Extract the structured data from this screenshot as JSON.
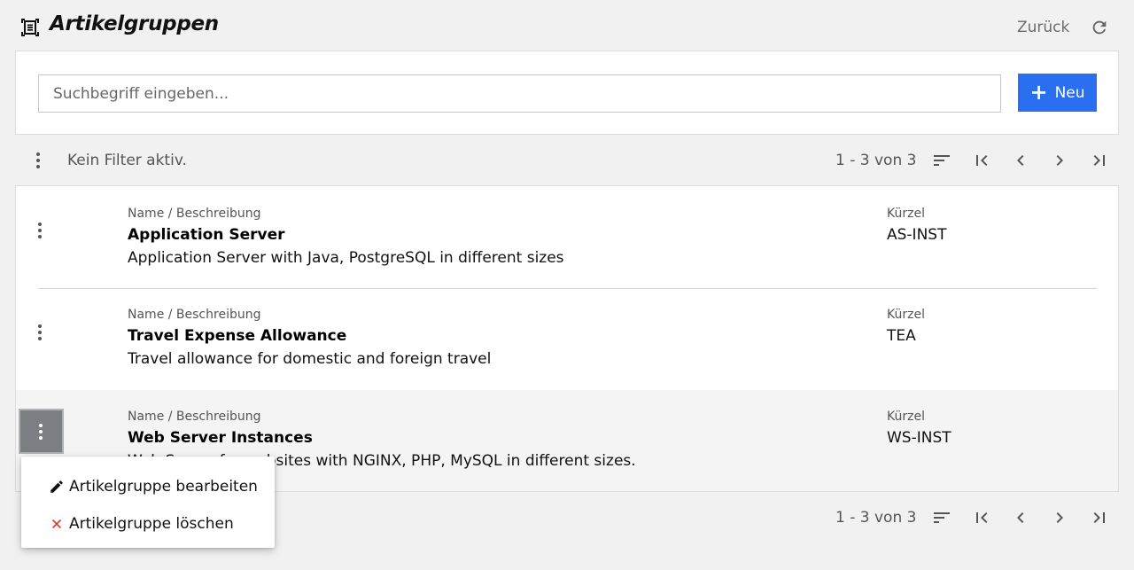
{
  "header": {
    "title": "Artikelgruppen",
    "back_label": "Zurück"
  },
  "search": {
    "placeholder": "Suchbegriff eingeben...",
    "value": "",
    "new_label": "Neu"
  },
  "toolbar": {
    "filter_text": "Kein Filter aktiv.",
    "pager_count": "1 - 3 von 3"
  },
  "list": {
    "name_header": "Name / Beschreibung",
    "code_header": "Kürzel",
    "items": [
      {
        "name": "Application Server",
        "description": "Application Server with Java, PostgreSQL in different sizes",
        "code": "AS-INST"
      },
      {
        "name": "Travel Expense Allowance",
        "description": "Travel allowance for domestic and foreign travel",
        "code": "TEA"
      },
      {
        "name": "Web Server Instances",
        "description": "Web Server for websites with NGINX, PHP, MySQL in different sizes.",
        "code": "WS-INST"
      }
    ]
  },
  "context_menu": {
    "edit_label": "Artikelgruppe bearbeiten",
    "delete_label": "Artikelgruppe löschen"
  },
  "colors": {
    "accent": "#2a6ff0",
    "delete": "#e53935",
    "selected_menu_button": "#7b7e82"
  },
  "icons": {
    "logo": "list-frame-icon",
    "refresh": "refresh-icon",
    "more": "vertical-dots-icon",
    "sort": "sort-icon",
    "first_page": "first-page-icon",
    "prev_page": "chevron-left-icon",
    "next_page": "chevron-right-icon",
    "last_page": "last-page-icon",
    "edit": "pencil-icon",
    "delete": "close-icon"
  }
}
